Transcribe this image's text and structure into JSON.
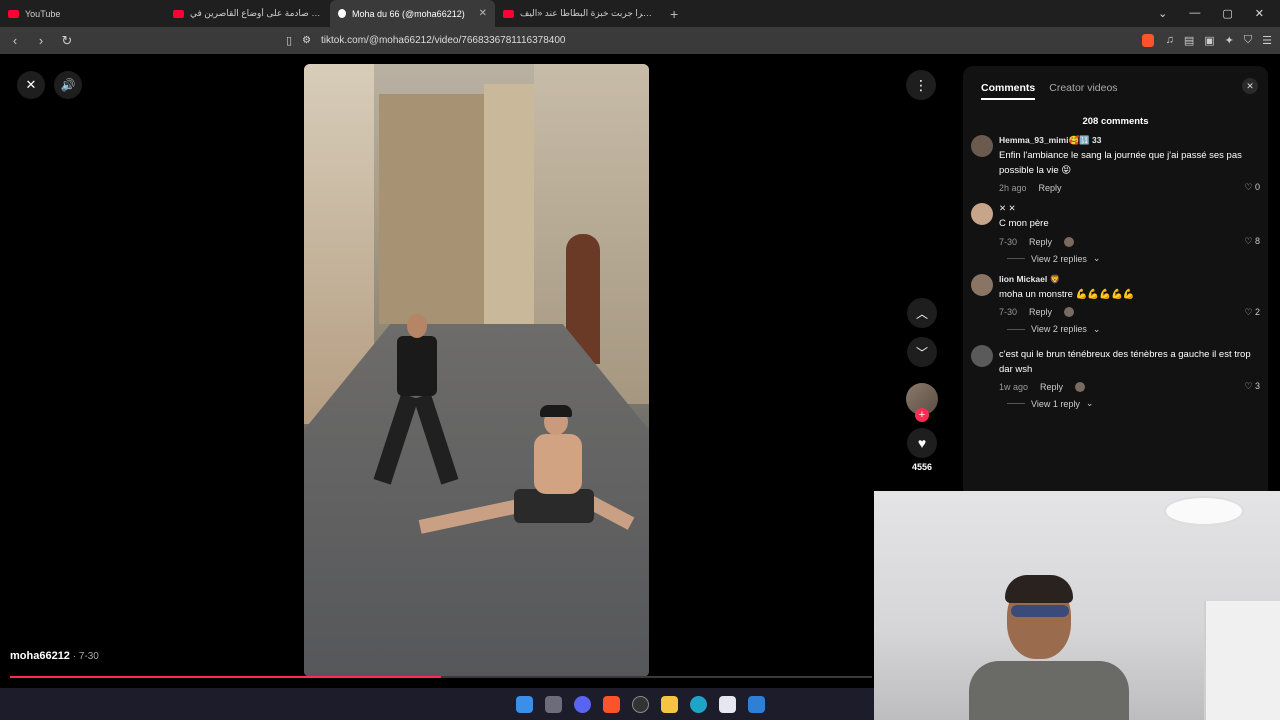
{
  "browser": {
    "tabs": [
      {
        "label": "YouTube",
        "favicon": "youtube-icon",
        "active": false
      },
      {
        "label": "حقائق صادمة على أوضاع القاصرين في...",
        "favicon": "youtube-icon",
        "active": false
      },
      {
        "label": "Moha du 66 (@moha66212)",
        "favicon": "tiktok-icon",
        "active": true
      },
      {
        "label": "أخيرا جربت خبزة البطاطا عند «اليف...",
        "favicon": "youtube-icon",
        "active": false
      }
    ],
    "new_tab_glyph": "+",
    "url": "tiktok.com/@moha66212/video/7668336781116378400"
  },
  "player": {
    "author": "moha66212",
    "date_suffix": " · 7-30",
    "likes": "4556",
    "progress": 0.5
  },
  "comments_panel": {
    "tab_comments": "Comments",
    "tab_creator_videos": "Creator videos",
    "count_label": "208 comments",
    "comments": [
      {
        "name": "Hemma_93_mimi🥰🔢 33",
        "text": "Enfin l'ambiance le sang la journée que j'ai passé ses pas possible la vie 😝",
        "time": "2h ago",
        "reply": "Reply",
        "likes": "0"
      },
      {
        "name": "✕ ✕",
        "text": "C mon père",
        "time": "7-30",
        "reply": "Reply",
        "likes": "8",
        "replies": "View 2 replies"
      },
      {
        "name": "lion Mickael 🦁",
        "text": "moha un monstre 💪💪💪💪💪",
        "time": "7-30",
        "reply": "Reply",
        "likes": "2",
        "replies": "View 2 replies"
      },
      {
        "name": "",
        "text": "c'est qui le brun ténébreux des ténèbres a gauche il est trop dar wsh",
        "time": "1w ago",
        "reply": "Reply",
        "likes": "3",
        "replies": "View 1 reply"
      }
    ]
  },
  "colors": {
    "accent": "#fe2c55",
    "panel_bg": "#121212"
  }
}
